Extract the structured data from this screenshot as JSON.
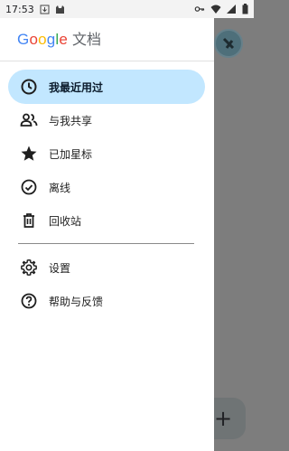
{
  "status_bar": {
    "time": "17:53"
  },
  "drawer": {
    "brand": {
      "google_letters": [
        {
          "ch": "G",
          "color": "#4285F4"
        },
        {
          "ch": "o",
          "color": "#EA4335"
        },
        {
          "ch": "o",
          "color": "#FBBC05"
        },
        {
          "ch": "g",
          "color": "#4285F4"
        },
        {
          "ch": "l",
          "color": "#34A853"
        },
        {
          "ch": "e",
          "color": "#EA4335"
        }
      ],
      "product": "文档"
    },
    "items": [
      {
        "label": "我最近用过",
        "icon": "clock-icon",
        "active": true
      },
      {
        "label": "与我共享",
        "icon": "people-icon",
        "active": false
      },
      {
        "label": "已加星标",
        "icon": "star-icon",
        "active": false
      },
      {
        "label": "离线",
        "icon": "offline-check-icon",
        "active": false
      },
      {
        "label": "回收站",
        "icon": "trash-icon",
        "active": false
      }
    ],
    "secondary_items": [
      {
        "label": "设置",
        "icon": "gear-icon"
      },
      {
        "label": "帮助与反馈",
        "icon": "help-icon"
      }
    ]
  },
  "background": {
    "fab_symbol": "+"
  },
  "colors": {
    "active_bg": "#c2e7ff",
    "scrim": "#7d7d7d"
  }
}
